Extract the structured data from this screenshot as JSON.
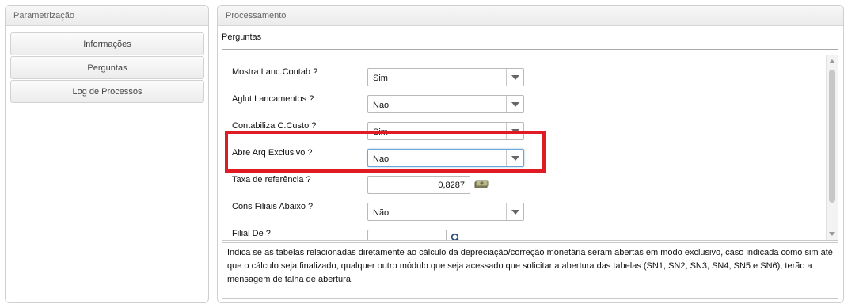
{
  "left_panel": {
    "title": "Parametrização",
    "items": [
      {
        "label": "Informações"
      },
      {
        "label": "Perguntas"
      },
      {
        "label": "Log de Processos"
      }
    ]
  },
  "right_panel": {
    "title": "Processamento",
    "subtitle": "Perguntas",
    "questions": [
      {
        "label": "Mostra Lanc.Contab ?",
        "value": "Sim"
      },
      {
        "label": "Aglut Lancamentos ?",
        "value": "Nao"
      },
      {
        "label": "Contabiliza C.Custo ?",
        "value": "Sim"
      },
      {
        "label": "Abre Arq Exclusivo ?",
        "value": "Nao"
      },
      {
        "label": "Taxa de referência ?",
        "value": "0,8287"
      },
      {
        "label": "Cons Filiais Abaixo ?",
        "value": "Não"
      },
      {
        "label": "Filial De ?",
        "value": ""
      }
    ],
    "help_text": "Indica se as tabelas relacionadas diretamente ao cálculo da depreciação/correção monetária seram abertas em modo exclusivo, caso indicada como sim até que o cálculo seja finalizado, qualquer outro módulo que seja acessado que solicitar a abertura das tabelas (SN1, SN2, SN3, SN4, SN5 e SN6), terão a mensagem de falha de abertura."
  },
  "colors": {
    "highlight": "#e01b24",
    "focus": "#6aa7d8"
  },
  "icons": {
    "currency": "money-icon",
    "search": "magnifier-icon"
  }
}
